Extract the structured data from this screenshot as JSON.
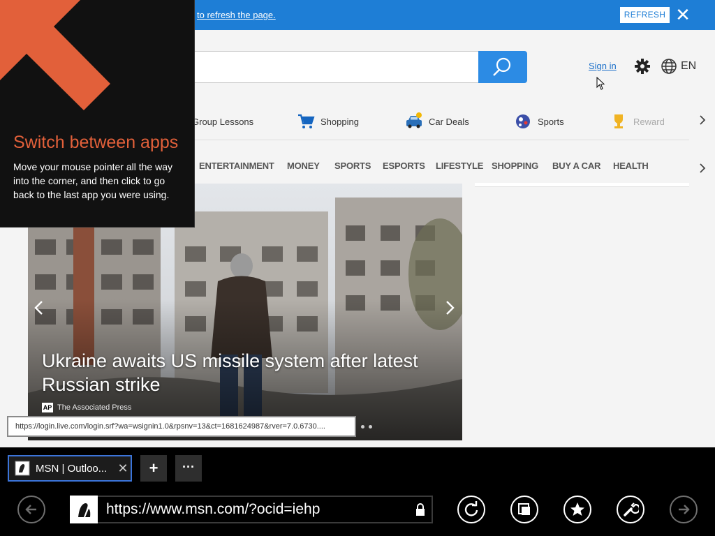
{
  "notification": {
    "message": "to refresh the page.",
    "refresh_label": "REFRESH",
    "close_symbol": "✕"
  },
  "header": {
    "search_placeholder": "",
    "sign_in": "Sign in",
    "language": "EN",
    "icons": [
      "search-icon",
      "gear-icon",
      "globe-icon"
    ]
  },
  "quick_links": [
    {
      "label": "Group Lessons",
      "icon": "group-lessons-icon"
    },
    {
      "label": "Shopping",
      "icon": "shopping-cart-icon"
    },
    {
      "label": "Car Deals",
      "icon": "car-icon"
    },
    {
      "label": "Sports",
      "icon": "sports-ball-icon"
    },
    {
      "label": "Reward",
      "icon": "trophy-icon"
    }
  ],
  "categories": [
    "ENTERTAINMENT",
    "MONEY",
    "SPORTS",
    "ESPORTS",
    "LIFESTYLE",
    "SHOPPING",
    "BUY A CAR",
    "HEALTH"
  ],
  "hero": {
    "title": "Ukraine awaits US missile system after latest Russian strike",
    "source_logo": "AP",
    "source": "The Associated Press"
  },
  "status_tip": "https://login.live.com/login.srf?wa=wsignin1.0&rpsnv=13&ct=1681624987&rver=7.0.6730....",
  "switch_apps": {
    "title": "Switch between apps",
    "body": "Move your mouse pointer all the way into the corner, and then click to go back to the last app you were using.",
    "accent": "#e2603a"
  },
  "tabs": {
    "active_title": "MSN | Outloo...",
    "close_symbol": "✕",
    "new_tab_symbol": "+",
    "more_symbol": "···"
  },
  "address_bar": {
    "url": "https://www.msn.com/?ocid=iehp"
  },
  "colors": {
    "accent_blue": "#1e7ed6",
    "search_button": "#2c8be4",
    "tab_border": "#3b74d9"
  }
}
